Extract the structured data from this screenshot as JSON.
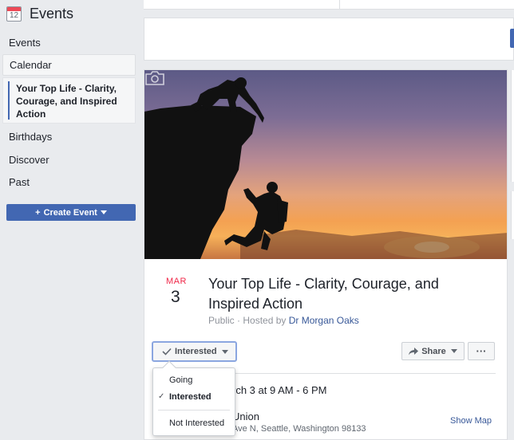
{
  "sidebar": {
    "calendar_icon_day": "12",
    "title": "Events",
    "items": [
      {
        "label": "Events"
      },
      {
        "label": "Calendar"
      },
      {
        "label": "Your Top Life - Clarity, Courage, and Inspired Action"
      },
      {
        "label": "Birthdays"
      },
      {
        "label": "Discover"
      },
      {
        "label": "Past"
      }
    ],
    "create_event_label": "Create Event"
  },
  "event": {
    "month": "MAR",
    "day": "3",
    "title": "Your Top Life - Clarity, Courage, and Inspired Action",
    "visibility": "Public",
    "hosted_by_label": "Hosted by",
    "host": "Dr Morgan Oaks",
    "when": "rch 3 at 9 AM - 6 PM",
    "venue": "Union",
    "address": "Ave N, Seattle, Washington 98133",
    "show_map_label": "Show Map"
  },
  "actions": {
    "interested_label": "Interested",
    "share_label": "Share",
    "more_label": "···"
  },
  "rsvp_menu": {
    "options": [
      "Going",
      "Interested",
      "Not Interested"
    ],
    "selected": "Interested"
  },
  "icons": {
    "calendar": "calendar-icon",
    "camera": "camera-icon",
    "check": "check-icon",
    "share": "share-arrow-icon",
    "plus": "plus-icon",
    "caret": "caret-down-icon"
  },
  "colors": {
    "brand_blue": "#4267b2",
    "link_blue": "#385898",
    "date_red": "#f02849",
    "focus_border": "#8ba6e0"
  }
}
